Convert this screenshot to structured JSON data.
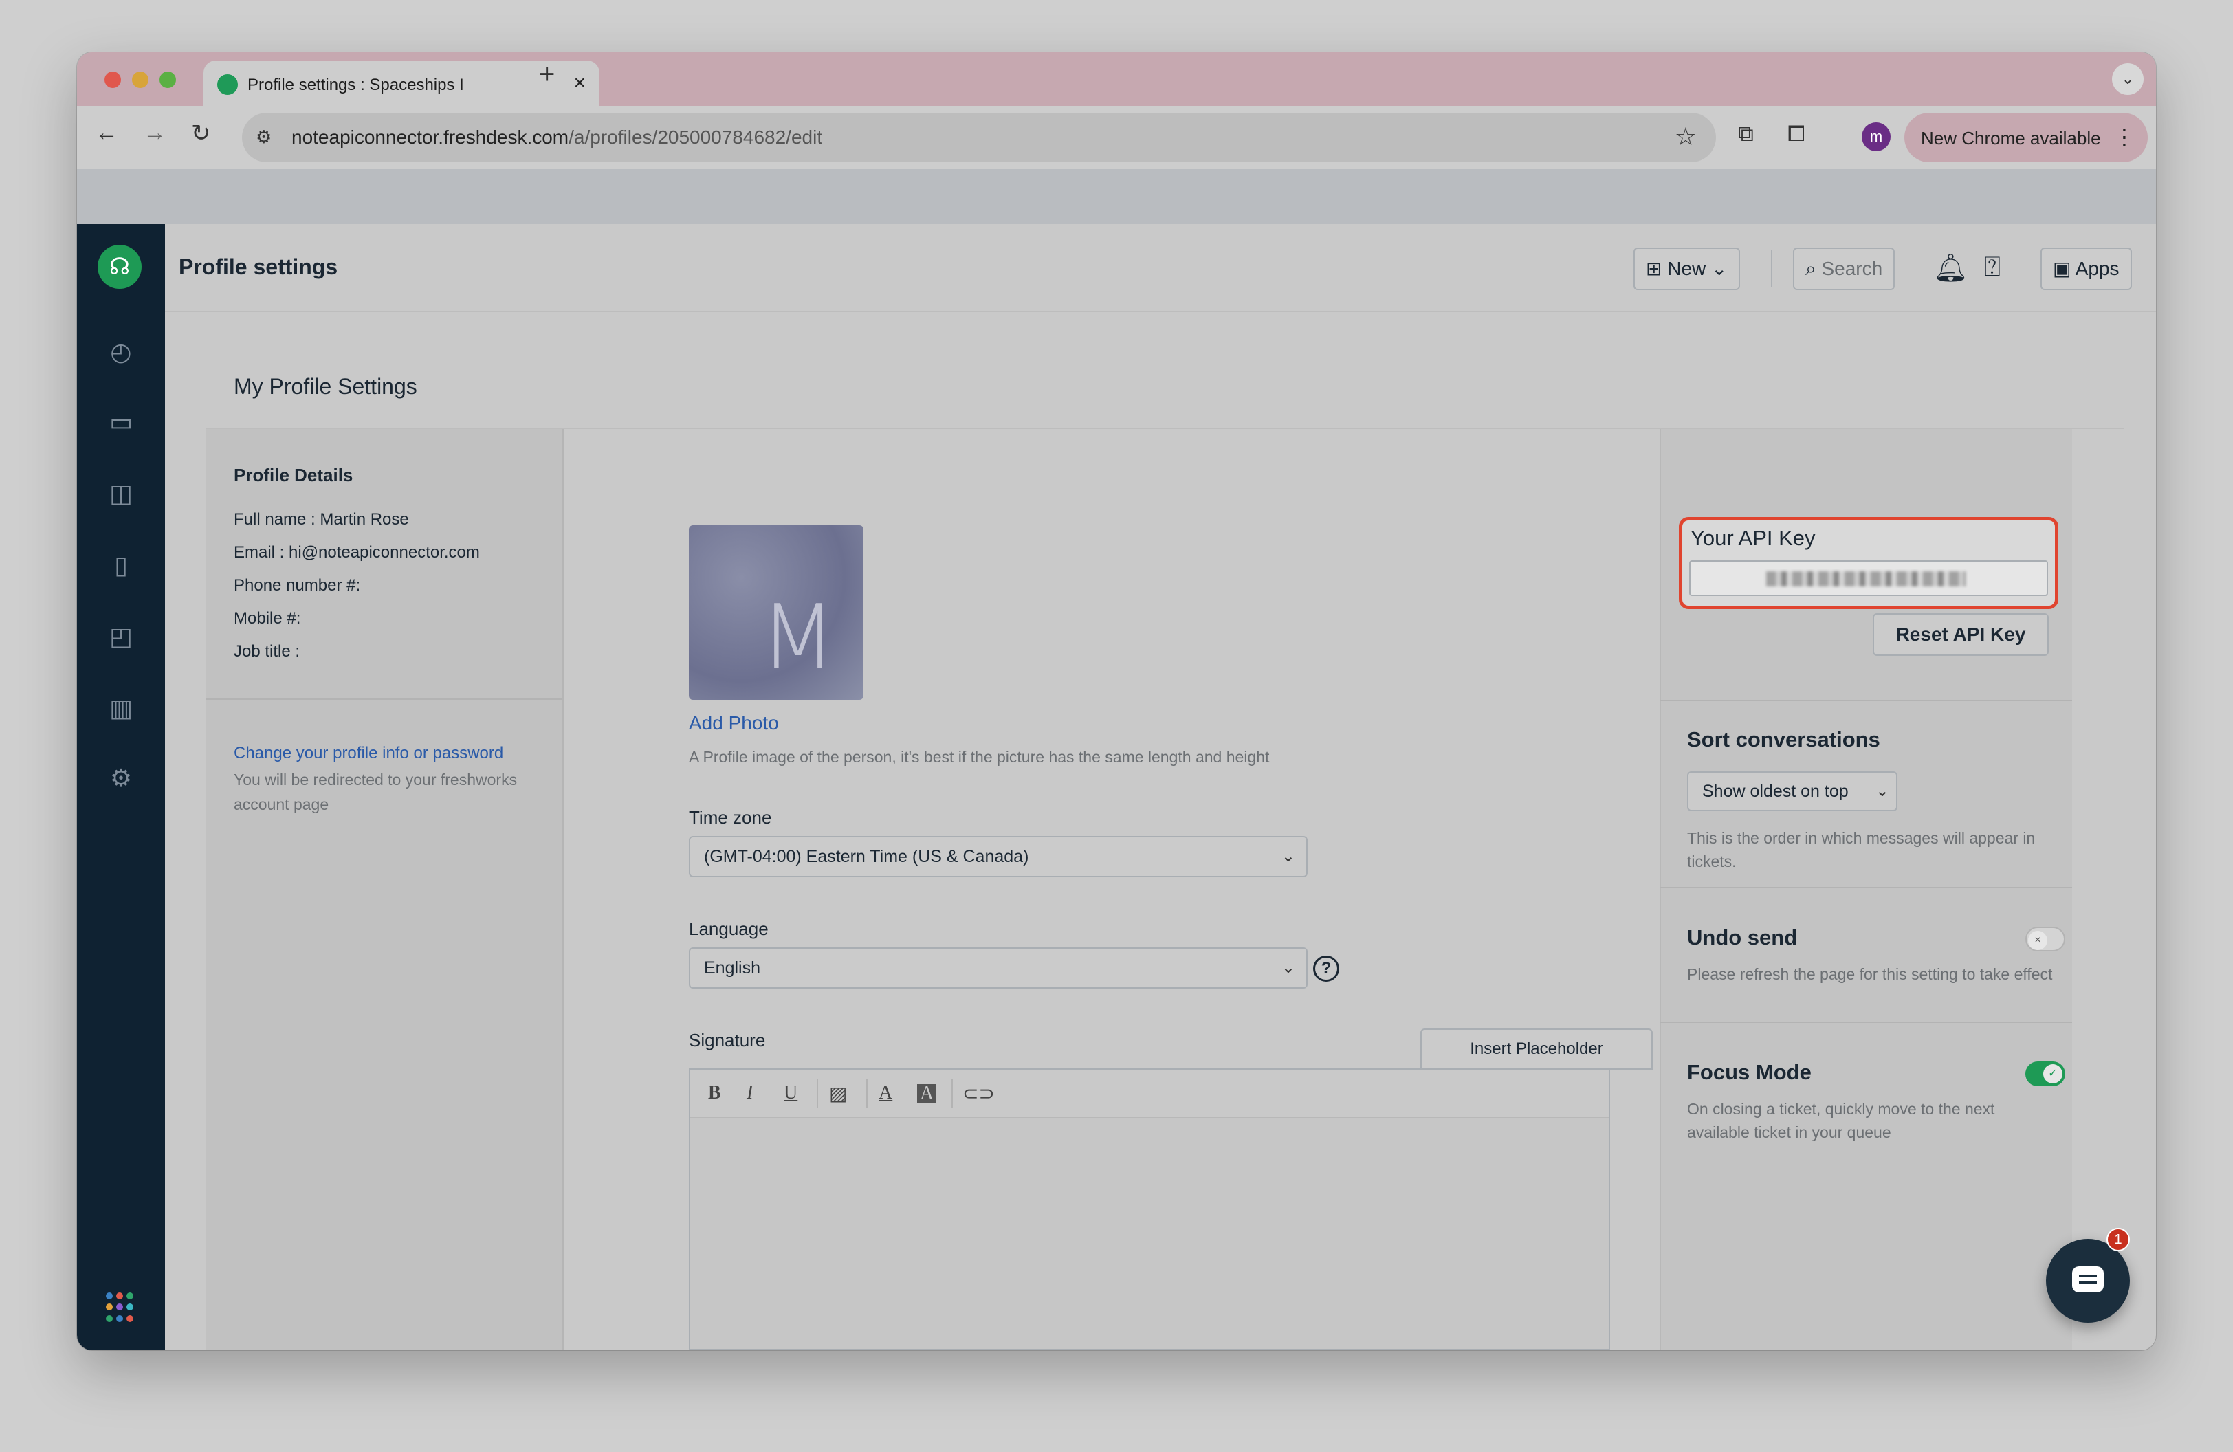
{
  "browser": {
    "tab_title": "Profile settings : Spaceships I",
    "url_host": "noteapiconnector.freshdesk.com",
    "url_path": "/a/profiles/205000784682/edit",
    "new_chrome_label": "New Chrome available",
    "profile_initial": "m"
  },
  "header": {
    "title": "Profile settings",
    "new_label": "New",
    "search_placeholder": "Search",
    "apps_label": "Apps",
    "avatar_initial": "M"
  },
  "page": {
    "title": "My Profile Settings"
  },
  "profile_details": {
    "heading": "Profile Details",
    "rows": [
      "Full name : Martin Rose",
      "Email : hi@noteapiconnector.com",
      "Phone number #:",
      "Mobile #:",
      "Job title :"
    ],
    "change_link": "Change your profile info or password",
    "redirect_note": "You will be redirected to your freshworks account page"
  },
  "photo": {
    "initial": "M",
    "add_label": "Add Photo",
    "hint": "A Profile image of the person, it's best if the picture has the same length and height"
  },
  "timezone": {
    "label": "Time zone",
    "value": "(GMT-04:00) Eastern Time (US & Canada)"
  },
  "language": {
    "label": "Language",
    "value": "English"
  },
  "signature": {
    "label": "Signature",
    "insert_placeholder": "Insert Placeholder",
    "toolbar": [
      "B",
      "I",
      "U",
      "image",
      "A",
      "A",
      "link"
    ]
  },
  "api": {
    "label": "Your API Key",
    "reset_label": "Reset API Key"
  },
  "sort": {
    "heading": "Sort conversations",
    "value": "Show oldest on top",
    "note": "This is the order in which messages will appear in tickets."
  },
  "undo_send": {
    "heading": "Undo send",
    "note": "Please refresh the page for this setting to take effect",
    "enabled": false
  },
  "focus_mode": {
    "heading": "Focus Mode",
    "note": "On closing a ticket, quickly move to the next available ticket in your queue",
    "enabled": true
  },
  "chat": {
    "badge": "1"
  },
  "colors": {
    "sidebar": "#0f2232",
    "brand_green": "#1e9a55",
    "link": "#2a5aa8",
    "highlight": "#e0442f",
    "toggle_on": "#1e9a55"
  }
}
